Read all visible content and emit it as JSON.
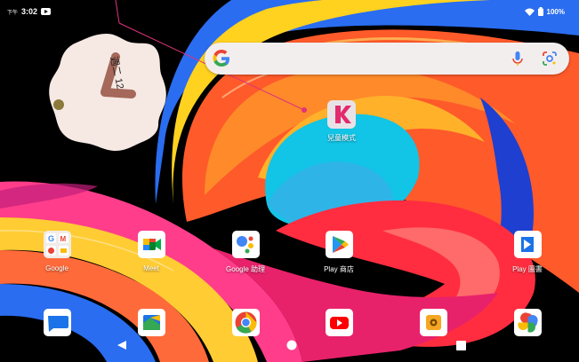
{
  "status_bar": {
    "time_prefix": "下午",
    "time": "3:02",
    "battery": "100%",
    "icons": [
      "youtube-notification-icon",
      "wifi-icon",
      "battery-icon"
    ]
  },
  "clock_widget": {
    "date": "週二 12"
  },
  "search_bar": {
    "icons": [
      "google-logo-icon",
      "microphone-icon",
      "lens-icon"
    ]
  },
  "kids_mode": {
    "label": "兒童模式"
  },
  "apps_row": [
    {
      "label": "Google",
      "icon": "google-folder-icon"
    },
    {
      "label": "Meet",
      "icon": "meet-icon"
    },
    {
      "label": "Google 助理",
      "icon": "assistant-icon"
    },
    {
      "label": "Play 商店",
      "icon": "play-store-icon"
    },
    {
      "label": "Play 圖書",
      "icon": "play-books-icon"
    }
  ],
  "dock": [
    {
      "icon": "messages-icon"
    },
    {
      "icon": "files-icon"
    },
    {
      "icon": "chrome-icon"
    },
    {
      "icon": "youtube-icon"
    },
    {
      "icon": "settings-app-icon"
    },
    {
      "icon": "photos-icon"
    }
  ],
  "nav_bar": {
    "icons": [
      "back-icon",
      "home-icon",
      "recents-icon"
    ]
  },
  "colors": {
    "pointer": "#e0337a",
    "clock_face": "#f6e9e4",
    "clock_hand": "#a5685a"
  }
}
